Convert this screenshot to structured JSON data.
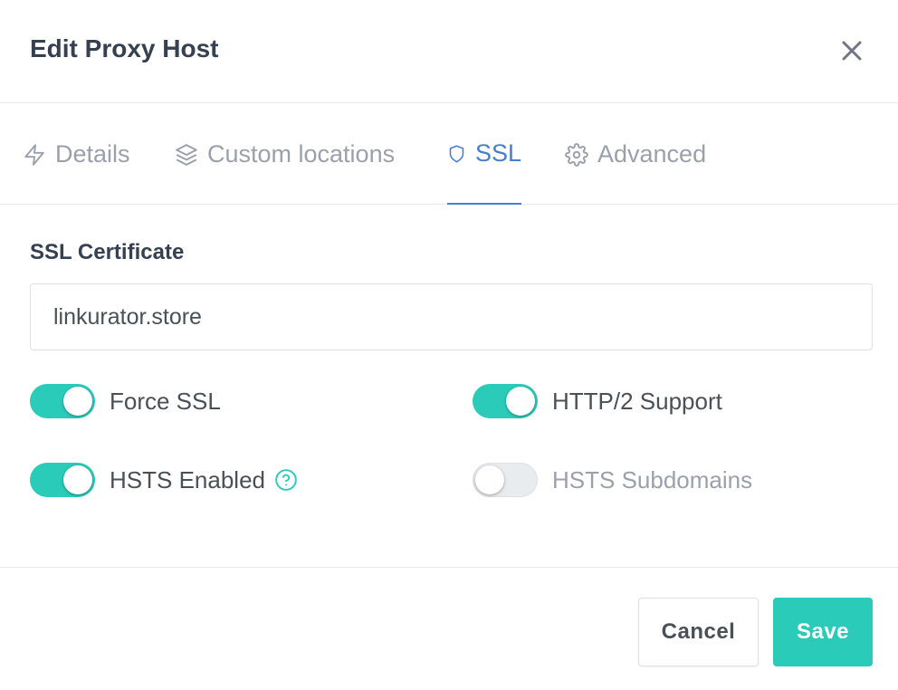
{
  "modal": {
    "title": "Edit Proxy Host",
    "close_icon": "close-icon"
  },
  "tabs": [
    {
      "label": "Details",
      "icon": "lightning-icon",
      "active": false
    },
    {
      "label": "Custom locations",
      "icon": "layers-icon",
      "active": false
    },
    {
      "label": "SSL",
      "icon": "shield-icon",
      "active": true
    },
    {
      "label": "Advanced",
      "icon": "gear-icon",
      "active": false
    }
  ],
  "ssl": {
    "certificate_label": "SSL Certificate",
    "certificate_value": "linkurator.store",
    "switches": [
      {
        "label": "Force SSL",
        "on": true
      },
      {
        "label": "HTTP/2 Support",
        "on": true
      },
      {
        "label": "HSTS Enabled",
        "on": true,
        "help_icon": "help-icon"
      },
      {
        "label": "HSTS Subdomains",
        "on": false
      }
    ]
  },
  "footer": {
    "cancel_label": "Cancel",
    "save_label": "Save"
  },
  "colors": {
    "accent_teal": "#2bcbba",
    "active_tab_blue": "#467fcf",
    "title": "#354052",
    "muted": "#9aa0ac"
  }
}
